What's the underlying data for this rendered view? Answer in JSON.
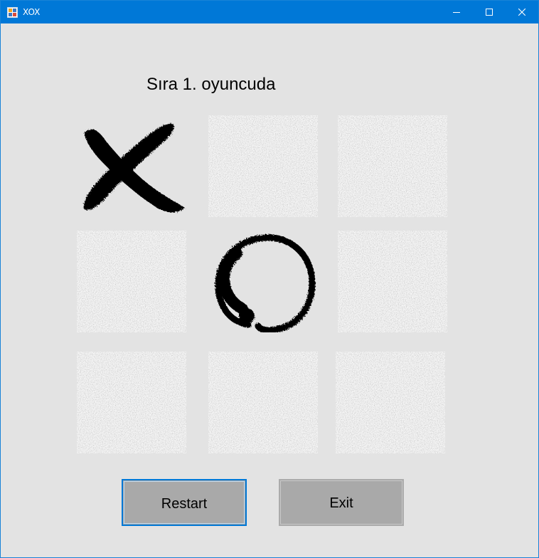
{
  "window": {
    "title": "XOX",
    "controls": {
      "minimize": "minimize-icon",
      "maximize": "maximize-icon",
      "close": "close-icon"
    },
    "accent_color": "#0078d7"
  },
  "status": {
    "text": "Sıra 1. oyuncuda"
  },
  "board": {
    "rows": 3,
    "cols": 3,
    "cells": [
      "X",
      "",
      "",
      "",
      "O",
      "",
      "",
      "",
      ""
    ],
    "empty_texture": "grunge-paper",
    "mark_color": "#000000"
  },
  "buttons": {
    "restart_label": "Restart",
    "exit_label": "Exit",
    "button_color": "#a9a9a9"
  }
}
